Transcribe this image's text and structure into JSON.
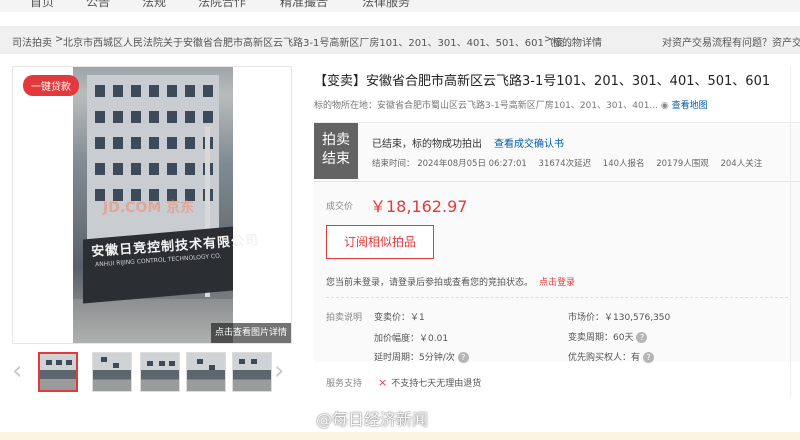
{
  "topnav": {
    "items": [
      "首页",
      "公告",
      "法规",
      "法院合作",
      "精准撮合",
      "法律服务"
    ]
  },
  "breadcrumb": {
    "items": [
      "司法拍卖",
      "北京市西城区人民法院关于安徽省合肥市高新区云飞路3-1号高新区厂房101、201、301、401、501、601（变…",
      "标的物详情"
    ],
    "separator": ">",
    "help_link": "对资产交易流程有问题？资产交易"
  },
  "gallery": {
    "badge": "一键贷款",
    "sign_text": "安徽日竞控制技术有限公司",
    "sign_sub": "ANHUI RIJING CONTROL TECHNOLOGY CO.",
    "watermark": "JD.COM 京东",
    "detail_button": "点击查看图片详情",
    "prev_arrow": "‹",
    "next_arrow": "›"
  },
  "item": {
    "title": "【变卖】安徽省合肥市高新区云飞路3-1号101、201、301、401、501、601",
    "location_prefix": "标的物所在地：",
    "location": "安徽省合肥市蜀山区云飞路3-1号高新区厂房101、201、301、401...",
    "map_link": "查看地图"
  },
  "status": {
    "box_line1": "拍卖",
    "box_line2": "结束",
    "text": "已结束，标的物成功拍出",
    "confirm_link": "查看成交确认书",
    "end_time": "结束时间：  2024年08月05日 06:27:01",
    "delays": "31674次延迟",
    "signups": "140人报名",
    "watchers": "20179人围观",
    "followers": "204人关注"
  },
  "deal": {
    "price_label": "成交价",
    "price": "￥18,162.97",
    "subscribe_button": "订阅相似拍品",
    "login_note": "您当前未登录，请登录后参拍或查看您的竞拍状态。",
    "login_link": "点击登录"
  },
  "specs": {
    "label": "拍卖说明",
    "start_price": "变卖价：￥1",
    "market_price": "市场价：￥130,576,350",
    "increment": "加价幅度：￥0.01",
    "sale_period": "变卖周期：60天",
    "delay_period": "延时周期：5分钟/次",
    "priority": "优先购买权人：有"
  },
  "service": {
    "label": "服务支持",
    "icon": "×",
    "text": "不支持七天无理由退货"
  },
  "weibo_watermark": "@每日经济新闻"
}
